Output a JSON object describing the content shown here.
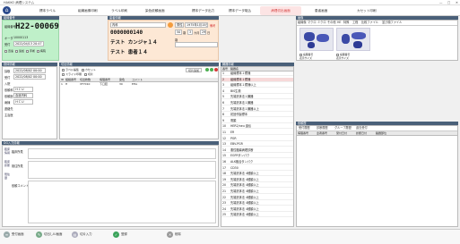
{
  "window": {
    "title": "HAKKO 病理システム",
    "controls": [
      "—",
      "□",
      "✕"
    ]
  },
  "toolbar": {
    "home_icon": "home-icon",
    "items": [
      "標本ラベル",
      "組織画像印刷",
      "ラベル印刷",
      "染色依頼画面",
      "",
      "標本データ出力",
      "標本データ取込",
      "病理切出画面",
      "患者画面",
      "カセット印刷"
    ],
    "active_index": 7
  },
  "patient": {
    "section_label": "組織番号",
    "case_no": "H22-00069",
    "order_label": "オーダ",
    "order_no": "10000113",
    "accept_label": "受付",
    "accept_date": "2022/04/13 20:47",
    "flags": [
      "迅速",
      "追加",
      "手術",
      "病院"
    ]
  },
  "patient_info": {
    "header": "患者情報",
    "dept": "内科",
    "gender": "男性",
    "birth": "1975年1月15日",
    "age": "50",
    "age_unit": "歳",
    "months": "3",
    "months_unit": "カ月",
    "days": "29",
    "days_unit": "日",
    "patient_id": "0000000140",
    "kana": "テスト カンジャ１４",
    "name": "テスト 患者１４",
    "remark_label": "備考",
    "label_age": "歳",
    "label_month": "月",
    "label_day": "日"
  },
  "image_panel": {
    "header": "画像",
    "tabs": [
      "組織像",
      "マクロ",
      "ミクロ",
      "その他",
      "HE",
      "特殊",
      "工程",
      "比較ファイル",
      "並び順ファイル"
    ],
    "images": [
      {
        "caption": "病理番号",
        "sub": "表示サイズ"
      },
      {
        "caption": "病理番号",
        "sub": "表示サイズ"
      }
    ]
  },
  "specimen_info": {
    "header": "検体情報",
    "rows": [
      {
        "label": "採取",
        "value": "2022/08/02 00:00"
      },
      {
        "label": "受付",
        "value": "2022/08/02 00:00"
      },
      {
        "label": "入院",
        "value": ""
      },
      {
        "label": "依頼科",
        "value": "ＨＣＵ"
      },
      {
        "label": "依頼医",
        "value": "血液内科"
      },
      {
        "label": "病棟",
        "value": "ＨＣＵ"
      },
      {
        "label": "連絡先",
        "value": ""
      },
      {
        "label": "主治医",
        "value": ""
      }
    ]
  },
  "slides": {
    "header": "切出情報",
    "options": [
      "ラベル編集",
      "カセット",
      "スライド印刷",
      "切片"
    ],
    "cols": [
      "ID",
      "組織番号",
      "切出枚数",
      "病理番号",
      "染色",
      "コメント"
    ],
    "rows": [
      {
        "id": "1",
        "tissue": "H",
        "cnt": "",
        "block": "VF7010",
        "qty": "下口腔",
        "stain": "30",
        "comment": "",
        "code": "EHA"
      }
    ],
    "new_label": "切片追加"
  },
  "organs": {
    "header": "臓器情報",
    "cols": [
      "番号",
      "臓器名"
    ],
    "items": [
      {
        "no": "1",
        "name": "組織標本１標識"
      },
      {
        "no": "2",
        "name": "組織標本１標識"
      },
      {
        "no": "3",
        "name": "組織標本１標識以上"
      },
      {
        "no": "4",
        "name": "BIS生検"
      },
      {
        "no": "5",
        "name": "先端抗体法１臓器"
      },
      {
        "no": "6",
        "name": "先端抗体法１臓器"
      },
      {
        "no": "7",
        "name": "先端抗体法１臓器以上"
      },
      {
        "no": "8",
        "name": "初回作製標本"
      },
      {
        "no": "9",
        "name": "電顕"
      },
      {
        "no": "10",
        "name": "HER2/neu 遺伝"
      },
      {
        "no": "11",
        "name": "ER"
      },
      {
        "no": "12",
        "name": "PGR"
      },
      {
        "no": "13",
        "name": "EBV-PGR"
      },
      {
        "no": "14",
        "name": "悪性腫瘍病理診断"
      },
      {
        "no": "15",
        "name": "EGFRタンパク"
      },
      {
        "no": "16",
        "name": "ALK融合タンパク"
      },
      {
        "no": "17",
        "name": "CD30"
      },
      {
        "no": "18",
        "name": "先端抗体法 4種類以上"
      },
      {
        "no": "19",
        "name": "先端抗体法 4種類以上"
      },
      {
        "no": "20",
        "name": "先端抗体法 4種類以上"
      },
      {
        "no": "21",
        "name": "先端抗体法 4種類以上"
      },
      {
        "no": "22",
        "name": "先端抗体法 4種類以上"
      },
      {
        "no": "23",
        "name": "先端抗体法 4種類以上"
      },
      {
        "no": "24",
        "name": "先端抗体法 4種類以上"
      },
      {
        "no": "25",
        "name": "先端抗体法 4種類以上"
      }
    ],
    "selected_index": 1
  },
  "history": {
    "header": "依頼歴",
    "tabs": [
      "受付履歴",
      "診断履歴",
      "グループ履歴",
      "過去受付"
    ],
    "cols": [
      "病理番号",
      "患者番号",
      "受付日付",
      "診断日付",
      "臓器部位"
    ]
  },
  "findings": {
    "header": "DG入力情報",
    "side_tabs": [
      "臨床情報",
      "臨床診断",
      "既往歴"
    ],
    "labels": [
      "臨床所見",
      "既往所見",
      "依頼コメント"
    ]
  },
  "bottom": {
    "items": [
      "受付画面",
      "切出しIU画面",
      "切片入力",
      "登録",
      "削除"
    ]
  },
  "colors": {
    "accent": "#d43a3a",
    "header": "#4a6079",
    "green": "#bff0c9",
    "pink": "#fde8d5",
    "select": "#f7d9d9"
  }
}
